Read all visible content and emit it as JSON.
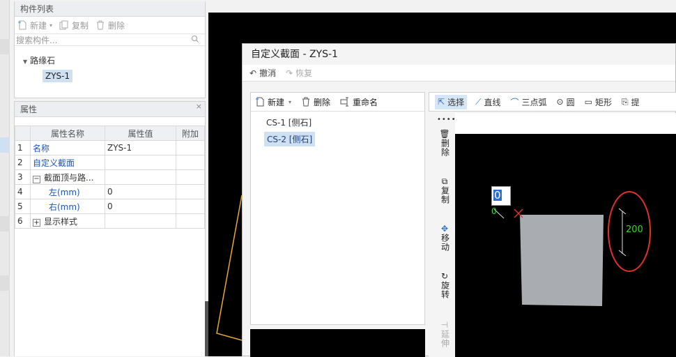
{
  "component_list": {
    "title": "构件列表",
    "new_label": "新建",
    "copy_label": "复制",
    "delete_label": "删除",
    "search_placeholder": "搜索构件...",
    "tree_parent": "路缘石",
    "tree_child": "ZYS-1"
  },
  "properties": {
    "title": "属性",
    "headers": [
      "属性名称",
      "属性值",
      "附加"
    ],
    "rows": [
      {
        "num": "1",
        "name": "名称",
        "value": "ZYS-1"
      },
      {
        "num": "2",
        "name": "自定义截面",
        "value": ""
      },
      {
        "num": "3",
        "name": "截面顶与路...",
        "value": ""
      },
      {
        "num": "4",
        "name": "左(mm)",
        "value": "0"
      },
      {
        "num": "5",
        "name": "右(mm)",
        "value": "0"
      },
      {
        "num": "6",
        "name": "显示样式",
        "value": ""
      }
    ]
  },
  "dialog": {
    "title": "自定义截面 - ZYS-1",
    "undo_label": "撤消",
    "redo_label": "恢复",
    "list_new": "新建",
    "list_delete": "删除",
    "list_rename": "重命名",
    "sections": [
      "CS-1 [侧石]",
      "CS-2 [侧石]"
    ],
    "draw_tools": {
      "select": "选择",
      "line": "直线",
      "arc": "三点弧",
      "circle": "圆",
      "rect": "矩形",
      "more": "提"
    },
    "side_tools": {
      "delete": "删除",
      "copy": "复制",
      "move": "移动",
      "rotate": "旋转",
      "extend": "延伸"
    },
    "canvas": {
      "input_value": "0",
      "small_label": "0",
      "dimension": "200"
    }
  },
  "colors": {
    "accent": "#1f55b5",
    "selected_bg": "#cfe0f3",
    "dimension_green": "#39d439",
    "marker_red": "#e03030",
    "shape_fill": "#a9adb2"
  }
}
